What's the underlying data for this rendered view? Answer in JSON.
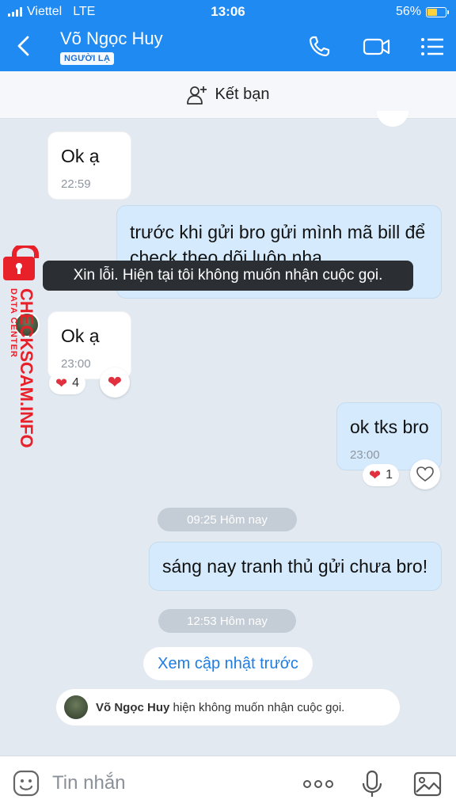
{
  "status": {
    "carrier": "Viettel",
    "network": "LTE",
    "time": "13:06",
    "battery": "56%",
    "battery_level": 0.56
  },
  "header": {
    "name": "Võ Ngọc Huy",
    "badge": "NGƯỜI LẠ"
  },
  "add_friend": {
    "label": "Kết bạn"
  },
  "messages": [
    {
      "text": "Ok ạ",
      "time": "22:59"
    },
    {
      "text_line1": "trước khi gửi bro gửi mình mã bill để",
      "text_line2": "check theo dõi luôn nha"
    },
    {
      "text": "Ok ạ",
      "time": "23:00",
      "reaction_count": "4"
    },
    {
      "text": "ok tks bro",
      "time": "23:00",
      "reaction_count": "1"
    },
    {
      "text": "sáng nay tranh thủ gửi chưa bro!"
    }
  ],
  "tooltip": "Xin lỗi. Hiện tại tôi không muốn nhận cuộc gọi.",
  "separators": [
    "09:25 Hôm nay",
    "12:53 Hôm nay"
  ],
  "load_more": "Xem cập nhật trước",
  "notice": {
    "name": "Võ Ngọc Huy",
    "text": "hiện không muốn nhận cuộc gọi."
  },
  "watermark": {
    "line1": "DATA CENTER",
    "line2": "CHECKSCAM.INFO",
    "color": "#e8202a"
  },
  "input": {
    "placeholder": "Tin nhắn"
  },
  "colors": {
    "header": "#1f8af2",
    "outgoing": "#d5ebfd",
    "accent": "#1f7ce3"
  }
}
